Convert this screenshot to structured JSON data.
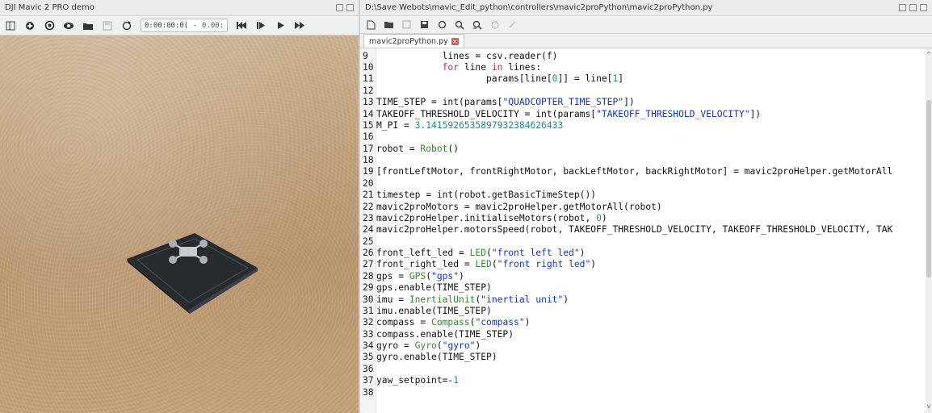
{
  "sim": {
    "title": "DJI Mavic 2 PRO demo",
    "time": "0:00:00:0( -",
    "speed": "0.00:",
    "toolbar_icons": [
      "layout-icon",
      "add-node-icon",
      "world-icon",
      "view-icon",
      "open-icon",
      "save-icon",
      "reload-icon",
      "time-field",
      "reset-icon",
      "step-icon",
      "play-icon",
      "fast-forward-icon"
    ]
  },
  "editor": {
    "path": "D:\\Save Webots\\mavic_Edit_python\\controllers\\mavic2proPython\\mavic2proPython.py",
    "tab_label": "mavic2proPython.py",
    "tab_close": "×",
    "toolbar_icons": [
      "new-file-icon",
      "open-file-icon",
      "save-icon",
      "save-all-icon",
      "reload-icon",
      "find-icon",
      "replace-icon",
      "undo-icon",
      "redo-icon"
    ],
    "lines": [
      {
        "n": "9",
        "t": "            lines = csv.reader(f)"
      },
      {
        "n": "10",
        "t": "            for line in lines:"
      },
      {
        "n": "11",
        "t": "                    params[line[0]] = line[1]"
      },
      {
        "n": "12",
        "t": ""
      },
      {
        "n": "13",
        "t": "TIME_STEP = int(params[\"QUADCOPTER_TIME_STEP\"])"
      },
      {
        "n": "14",
        "t": "TAKEOFF_THRESHOLD_VELOCITY = int(params[\"TAKEOFF_THRESHOLD_VELOCITY\"])"
      },
      {
        "n": "15",
        "t": "M_PI = 3.1415926535897932384626433"
      },
      {
        "n": "16",
        "t": ""
      },
      {
        "n": "17",
        "t": "robot = Robot()"
      },
      {
        "n": "18",
        "t": ""
      },
      {
        "n": "19",
        "t": "[frontLeftMotor, frontRightMotor, backLeftMotor, backRightMotor] = mavic2proHelper.getMotorAll"
      },
      {
        "n": "20",
        "t": ""
      },
      {
        "n": "21",
        "t": "timestep = int(robot.getBasicTimeStep())"
      },
      {
        "n": "22",
        "t": "mavic2proMotors = mavic2proHelper.getMotorAll(robot)"
      },
      {
        "n": "23",
        "t": "mavic2proHelper.initialiseMotors(robot, 0)"
      },
      {
        "n": "24",
        "t": "mavic2proHelper.motorsSpeed(robot, TAKEOFF_THRESHOLD_VELOCITY, TAKEOFF_THRESHOLD_VELOCITY, TAK"
      },
      {
        "n": "25",
        "t": ""
      },
      {
        "n": "26",
        "t": "front_left_led = LED(\"front left led\")"
      },
      {
        "n": "27",
        "t": "front_right_led = LED(\"front right led\")"
      },
      {
        "n": "28",
        "t": "gps = GPS(\"gps\")"
      },
      {
        "n": "29",
        "t": "gps.enable(TIME_STEP)"
      },
      {
        "n": "30",
        "t": "imu = InertialUnit(\"inertial unit\")"
      },
      {
        "n": "31",
        "t": "imu.enable(TIME_STEP)"
      },
      {
        "n": "32",
        "t": "compass = Compass(\"compass\")"
      },
      {
        "n": "33",
        "t": "compass.enable(TIME_STEP)"
      },
      {
        "n": "34",
        "t": "gyro = Gyro(\"gyro\")"
      },
      {
        "n": "35",
        "t": "gyro.enable(TIME_STEP)"
      },
      {
        "n": "36",
        "t": ""
      },
      {
        "n": "37",
        "t": "yaw_setpoint=-1"
      },
      {
        "n": "38",
        "t": ""
      }
    ]
  },
  "colors": {
    "keyword": "#b03060",
    "string": "#1133cc",
    "number": "#1d8a8a",
    "class": "#2e8b2e",
    "tab_close": "#e25b4a"
  }
}
